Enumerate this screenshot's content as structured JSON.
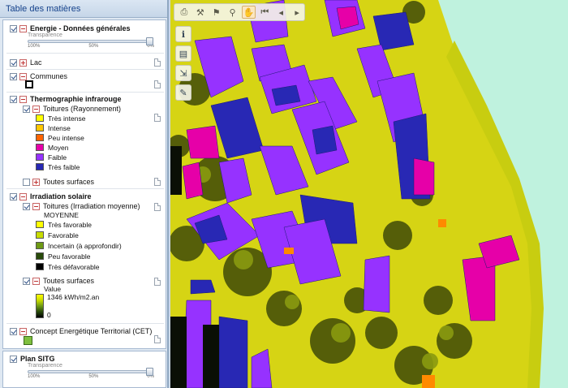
{
  "toc": {
    "title": "Table des matières",
    "slider": {
      "caption": "Transparence",
      "ticks": [
        "100%",
        "50%",
        "0%"
      ]
    },
    "groups": {
      "energie": {
        "label": "Energie - Données générales"
      },
      "lac": {
        "label": "Lac"
      },
      "communes": {
        "label": "Communes"
      },
      "thermo": {
        "label": "Thermographie infrarouge",
        "toitures": "Toitures (Rayonnement)",
        "legend": [
          {
            "label": "Très intense",
            "color": "#ffff00"
          },
          {
            "label": "Intense",
            "color": "#ffc800"
          },
          {
            "label": "Peu intense",
            "color": "#ff6400"
          },
          {
            "label": "Moyen",
            "color": "#e600a8"
          },
          {
            "label": "Faible",
            "color": "#9632ff"
          },
          {
            "label": "Très faible",
            "color": "#2828b4"
          }
        ],
        "surfaces": "Toutes surfaces"
      },
      "irradiation": {
        "label": "Irradiation solaire",
        "toitures": "Toitures (Irradiation moyenne)",
        "subhead": "MOYENNE",
        "legend": [
          {
            "label": "Très favorable",
            "color": "#ffff00"
          },
          {
            "label": "Favorable",
            "color": "#c8dc00"
          },
          {
            "label": "Incertain (à approfondir)",
            "color": "#6e9a14"
          },
          {
            "label": "Peu favorable",
            "color": "#284a0a"
          },
          {
            "label": "Très défavorable",
            "color": "#000000"
          }
        ],
        "surfaces": "Toutes surfaces",
        "value_title": "Value",
        "value_max": "1346 kWh/m2.an",
        "value_min": "0"
      },
      "cet": {
        "label": "Concept Energétique Territorial (CET)"
      },
      "sitg": {
        "label": "Plan SITG"
      }
    }
  },
  "toolbar": {
    "icons": [
      "print-icon",
      "measure-icon",
      "locate-icon",
      "search-icon",
      "pan-hand-icon",
      "first-icon",
      "prev-icon",
      "next-icon"
    ],
    "glyphs": [
      "⎙",
      "⚒",
      "⚑",
      "⚲",
      "✋",
      "⏮",
      "◂",
      "▸"
    ],
    "side_icons": [
      "info-icon",
      "print-layout-icon",
      "export-icon",
      "tools-icon"
    ],
    "side_glyphs": [
      "ℹ",
      "▤",
      "⇲",
      "✎"
    ]
  },
  "colors": {
    "map_background": "#bff2de",
    "vegetation": "#d6d414",
    "panel_border": "#8fa7c2"
  }
}
